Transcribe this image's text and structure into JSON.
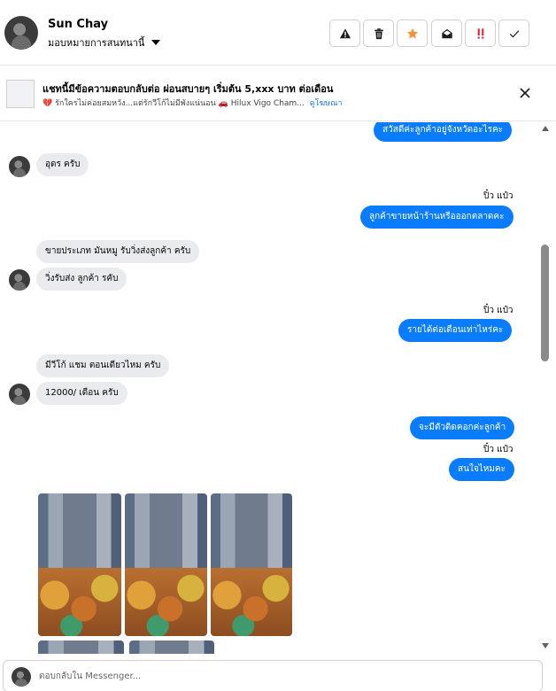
{
  "header": {
    "name": "Sun Chay",
    "assign_label": "มอบหมายการสนทนานี้",
    "actions": [
      {
        "icon": "warning-icon",
        "name": "report-button"
      },
      {
        "icon": "trash-icon",
        "name": "delete-button"
      },
      {
        "icon": "star-icon",
        "name": "star-button"
      },
      {
        "icon": "open-envelope-icon",
        "name": "mark-unread-button"
      },
      {
        "icon": "double-exclamation-icon",
        "name": "mark-spam-button"
      },
      {
        "icon": "checkmark-icon",
        "name": "mark-done-button"
      }
    ],
    "star_color": "#f7923a",
    "alert_color": "#e41e3f"
  },
  "ad": {
    "title": "แชทนี้มีข้อความตอบกลับต่อ ผ่อนสบายๆ เริ่มต้น 5,xxx บาท ต่อเดือน",
    "subtitle": "💔 รักใครไม่ค่อยสมหวัง...แต่รักวีโก้ไม่มีพังแน่นอน 🚗 Hilux Vigo Cham...",
    "link": "ดูโฆษณา"
  },
  "messages": {
    "m1": "สวัสดีค่ะลูกค้าอยู่จังหวัดอะไรคะ",
    "m2": "อุดร ครับ",
    "sender1": "ปิ๋ว แป๋ว",
    "m3": "ลูกค้าขายหน้าร้านหรือออกตลาดคะ",
    "m4": "ขายประเภท มันหมู รับวิ่งส่งลูกค้า ครับ",
    "m5": "วิ่งรับส่ง ลูกค้า รคับ",
    "sender2": "ปิ๋ว แป๋ว",
    "m6": "รายได้ต่อเดือนเท่าไหร่คะ",
    "m7": "มีวีโก้ แชม ตอนเดียวไหม ครับ",
    "m8": "12000/ เดือน ครับ",
    "m9": "จะมีตัวติดคอกค่ะลูกค้า",
    "sender3": "ปิ๋ว แป๋ว",
    "m10": "สนใจไหมคะ"
  },
  "colors": {
    "outgoing_bubble": "#0a7cff",
    "incoming_bubble": "#e9ebee",
    "link": "#1877f2"
  },
  "composer": {
    "placeholder": "ตอบกลับใน Messenger..."
  }
}
